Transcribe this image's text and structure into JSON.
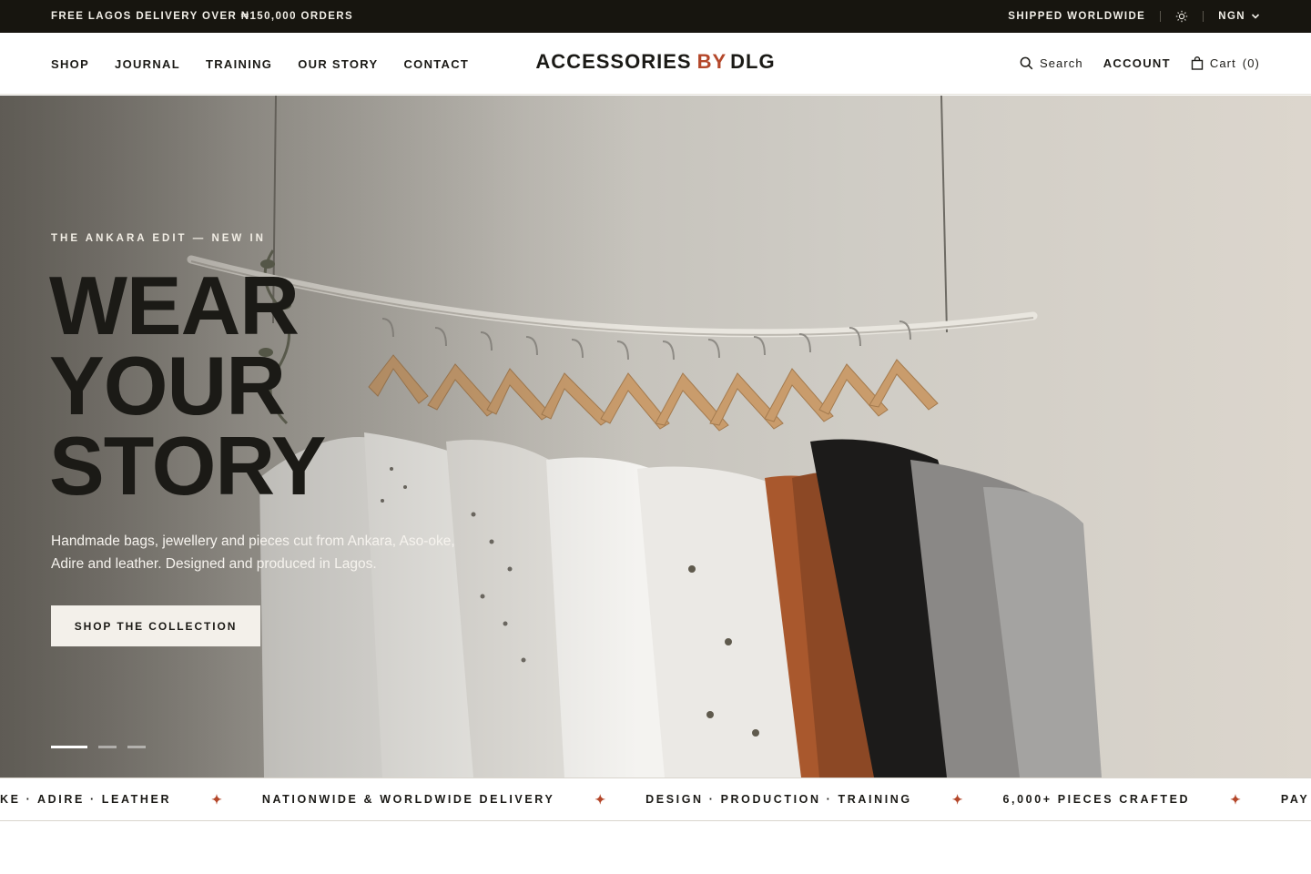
{
  "announcement": {
    "left_text": "FREE LAGOS DELIVERY OVER ₦150,000 ORDERS",
    "shipping_text": "SHIPPED WORLDWIDE",
    "theme_icon": "sun-icon",
    "currency": "NGN"
  },
  "header": {
    "nav": [
      "SHOP",
      "JOURNAL",
      "TRAINING",
      "OUR STORY",
      "CONTACT"
    ],
    "logo": {
      "part1": "ACCESSORIES",
      "part2": "BY",
      "part3": "DLG"
    },
    "search_label": "Search",
    "account_label": "ACCOUNT",
    "cart_label": "Cart",
    "cart_count": "(0)"
  },
  "hero": {
    "eyebrow": "THE ANKARA EDIT — NEW IN",
    "headline": [
      "WEAR",
      "YOUR",
      "STORY"
    ],
    "subtitle": "Handmade bags, jewellery and pieces cut from Ankara, Aso-oke, Adire and leather. Designed and produced in Lagos.",
    "cta_label": "SHOP THE COLLECTION",
    "slides_total": 3,
    "active_slide": 1
  },
  "ticker": {
    "items": [
      "KE · ADIRE · LEATHER",
      "NATIONWIDE & WORLDWIDE DELIVERY",
      "DESIGN · PRODUCTION · TRAINING",
      "6,000+ PIECES CRAFTED",
      "PAY IN YOUR CURRENC"
    ],
    "separator": "✦"
  },
  "colors": {
    "accent": "#b4472a",
    "dark": "#17150f",
    "cta_bg": "#f3f0ea"
  }
}
